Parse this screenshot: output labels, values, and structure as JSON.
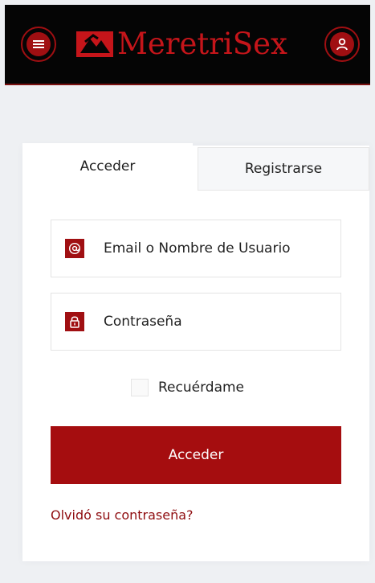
{
  "header": {
    "brand": "MeretriSex",
    "menu_icon": "hamburger-icon",
    "user_icon": "user-icon"
  },
  "tabs": [
    {
      "label": "Acceder"
    },
    {
      "label": "Registrarse"
    }
  ],
  "form": {
    "email_placeholder": "Email o Nombre de Usuario",
    "email_icon": "at-icon",
    "password_placeholder": "Contraseña",
    "password_icon": "lock-icon",
    "remember_label": "Recuérdame",
    "submit_label": "Acceder",
    "forgot_link": "Olvidó su contraseña?"
  },
  "colors": {
    "brand_red": "#a00f12",
    "header_bg": "#050505",
    "page_bg": "#eef0f3"
  }
}
